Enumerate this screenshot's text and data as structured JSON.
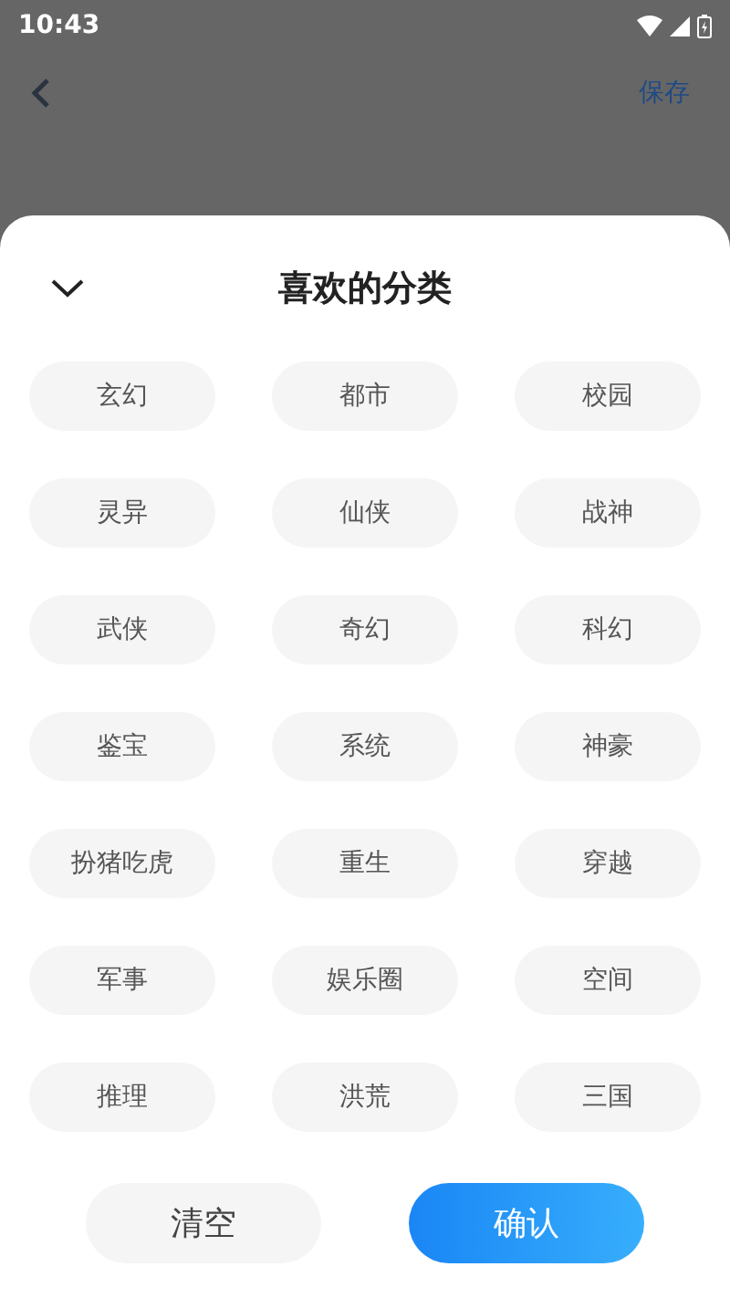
{
  "status_bar": {
    "time": "10:43"
  },
  "header": {
    "save": "保存"
  },
  "sheet": {
    "title": "喜欢的分类",
    "categories": [
      "玄幻",
      "都市",
      "校园",
      "灵异",
      "仙侠",
      "战神",
      "武侠",
      "奇幻",
      "科幻",
      "鉴宝",
      "系统",
      "神豪",
      "扮猪吃虎",
      "重生",
      "穿越",
      "军事",
      "娱乐圈",
      "空间",
      "推理",
      "洪荒",
      "三国"
    ],
    "buttons": [
      {
        "label": "清空",
        "kind": "secondary"
      },
      {
        "label": "确认",
        "kind": "primary"
      }
    ]
  }
}
